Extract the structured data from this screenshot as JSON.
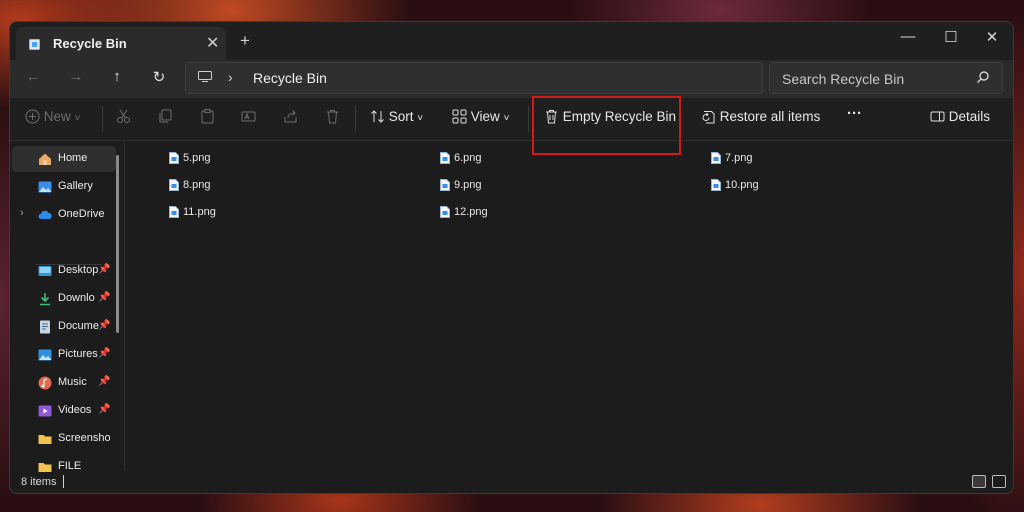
{
  "window": {
    "tab_title": "Recycle Bin",
    "tab_close": "✕",
    "new_tab": "+",
    "controls": {
      "minimize": "—",
      "maximize": "☐",
      "close": "✕"
    }
  },
  "nav": {
    "back": "←",
    "forward": "→",
    "up": "↑",
    "refresh": "↻",
    "breadcrumb_separator": "›",
    "address_text": "Recycle Bin",
    "search_placeholder": "Search Recycle Bin"
  },
  "toolbar": {
    "new_label": "New",
    "sort_label": "Sort",
    "view_label": "View",
    "empty_label": "Empty Recycle Bin",
    "restore_label": "Restore all items",
    "more_label": "···",
    "details_label": "Details",
    "dropdown_arrow": "˅"
  },
  "sidebar": {
    "expand_glyph": "›",
    "pin_glyph": "📌",
    "items": [
      {
        "label": "Home",
        "icon": "home-icon"
      },
      {
        "label": "Gallery",
        "icon": "gallery-icon"
      },
      {
        "label": "OneDrive",
        "icon": "onedrive-icon"
      },
      {
        "label": "Desktop",
        "icon": "desktop-icon"
      },
      {
        "label": "Downlo",
        "icon": "download-icon"
      },
      {
        "label": "Docume",
        "icon": "documents-icon"
      },
      {
        "label": "Pictures",
        "icon": "pictures-icon"
      },
      {
        "label": "Music",
        "icon": "music-icon"
      },
      {
        "label": "Videos",
        "icon": "videos-icon"
      },
      {
        "label": "Screenshot",
        "icon": "folder-icon"
      },
      {
        "label": "FILE",
        "icon": "folder-icon"
      }
    ]
  },
  "files": [
    "5.png",
    "6.png",
    "7.png",
    "8.png",
    "9.png",
    "10.png",
    "11.png",
    "12.png"
  ],
  "status": {
    "item_count": "8 items"
  },
  "colors": {
    "highlight": "#d21a1a",
    "accent": "#4aa3ff",
    "window_bg": "#1c1c1c"
  }
}
